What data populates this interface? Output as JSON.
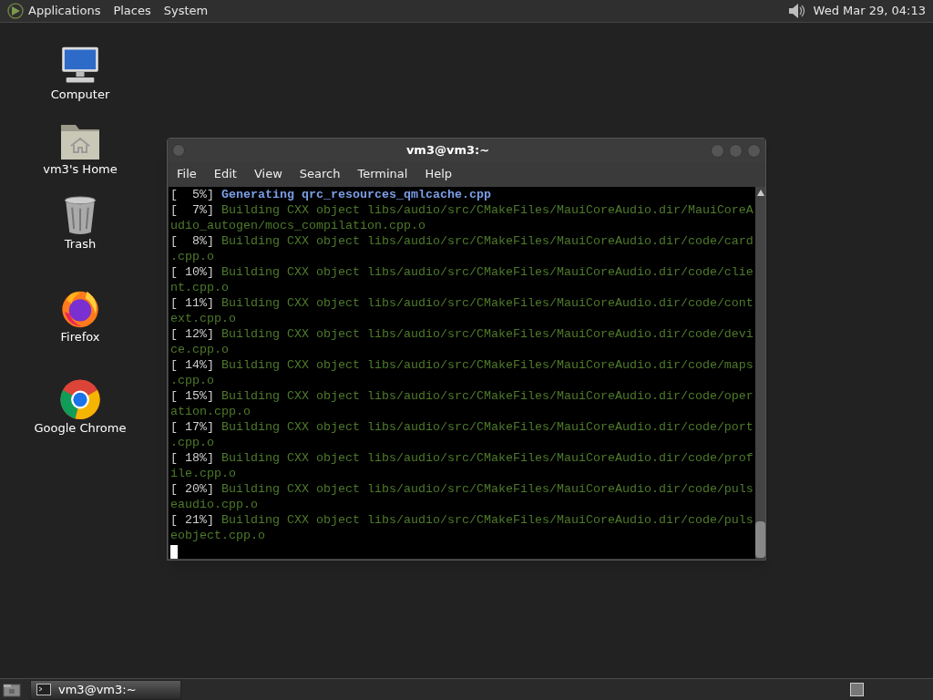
{
  "top_panel": {
    "menus": [
      "Applications",
      "Places",
      "System"
    ],
    "clock": "Wed Mar 29, 04:13"
  },
  "desktop_icons": [
    {
      "label": "Computer"
    },
    {
      "label": "vm3's Home"
    },
    {
      "label": "Trash"
    },
    {
      "label": "Firefox"
    },
    {
      "label": "Google Chrome"
    }
  ],
  "window": {
    "title": "vm3@vm3:~",
    "menu": [
      "File",
      "Edit",
      "View",
      "Search",
      "Terminal",
      "Help"
    ],
    "terminal_lines": [
      {
        "kind": "generating",
        "progress": "[  5%]",
        "message": "Generating qrc_resources_qmlcache.cpp"
      },
      {
        "kind": "building",
        "progress": "[  7%]",
        "message": "Building CXX object libs/audio/src/CMakeFiles/MauiCoreAudio.dir/MauiCoreAudio_autogen/mocs_compilation.cpp.o"
      },
      {
        "kind": "building",
        "progress": "[  8%]",
        "message": "Building CXX object libs/audio/src/CMakeFiles/MauiCoreAudio.dir/code/card.cpp.o"
      },
      {
        "kind": "building",
        "progress": "[ 10%]",
        "message": "Building CXX object libs/audio/src/CMakeFiles/MauiCoreAudio.dir/code/client.cpp.o"
      },
      {
        "kind": "building",
        "progress": "[ 11%]",
        "message": "Building CXX object libs/audio/src/CMakeFiles/MauiCoreAudio.dir/code/context.cpp.o"
      },
      {
        "kind": "building",
        "progress": "[ 12%]",
        "message": "Building CXX object libs/audio/src/CMakeFiles/MauiCoreAudio.dir/code/device.cpp.o"
      },
      {
        "kind": "building",
        "progress": "[ 14%]",
        "message": "Building CXX object libs/audio/src/CMakeFiles/MauiCoreAudio.dir/code/maps.cpp.o"
      },
      {
        "kind": "building",
        "progress": "[ 15%]",
        "message": "Building CXX object libs/audio/src/CMakeFiles/MauiCoreAudio.dir/code/operation.cpp.o"
      },
      {
        "kind": "building",
        "progress": "[ 17%]",
        "message": "Building CXX object libs/audio/src/CMakeFiles/MauiCoreAudio.dir/code/port.cpp.o"
      },
      {
        "kind": "building",
        "progress": "[ 18%]",
        "message": "Building CXX object libs/audio/src/CMakeFiles/MauiCoreAudio.dir/code/profile.cpp.o"
      },
      {
        "kind": "building",
        "progress": "[ 20%]",
        "message": "Building CXX object libs/audio/src/CMakeFiles/MauiCoreAudio.dir/code/pulseaudio.cpp.o"
      },
      {
        "kind": "building",
        "progress": "[ 21%]",
        "message": "Building CXX object libs/audio/src/CMakeFiles/MauiCoreAudio.dir/code/pulseobject.cpp.o"
      }
    ]
  },
  "taskbar": {
    "tasks": [
      {
        "label": "vm3@vm3:~",
        "selected": true
      }
    ]
  }
}
